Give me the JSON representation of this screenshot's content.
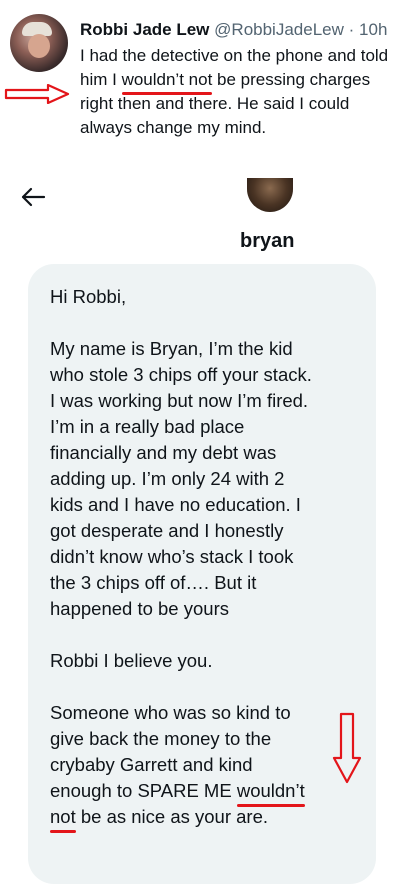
{
  "tweet": {
    "author_name": "Robbi Jade Lew",
    "author_handle": "@RobbiJadeLew",
    "separator": "·",
    "timestamp": "10h",
    "lines": {
      "l1": "I had the detective on the phone and told",
      "l2_pre": "him I ",
      "l2_underlined": "wouldn’t not",
      "l2_post": " be pressing charges",
      "l3": "right then and there. He said I could",
      "l4": "always change my mind."
    }
  },
  "dm": {
    "contact_name": "bryan",
    "message": {
      "p1": [
        "Hi Robbi,"
      ],
      "p2": [
        "My name is Bryan, I’m the kid",
        "who stole 3 chips off your stack.",
        "I was working but now I’m fired.",
        "I’m in a really bad place",
        "financially and my debt was",
        "adding up. I’m only 24 with 2",
        "kids and I have no education. I",
        "got desperate and I honestly",
        "didn’t know who’s stack I took",
        "the 3 chips off of…. But it",
        "happened to be yours"
      ],
      "p3": [
        "Robbi I believe you."
      ],
      "p4": [
        "Someone who was so kind to",
        "give back the money to the",
        "crybaby Garrett and kind"
      ],
      "p4_l4_pre": "enough to SPARE ME ",
      "p4_l4_underlined": "wouldn’t",
      "p4_l5_underlined": "not",
      "p4_l5_post": " be as nice as your are."
    }
  },
  "icons": {
    "back": "arrow-left-icon",
    "annotation_1": "red-arrow-right-icon",
    "annotation_2": "red-arrow-down-icon"
  },
  "colors": {
    "annotation_red": "#e3151a",
    "bubble_bg": "#eef3f4",
    "secondary_text": "#536471"
  }
}
